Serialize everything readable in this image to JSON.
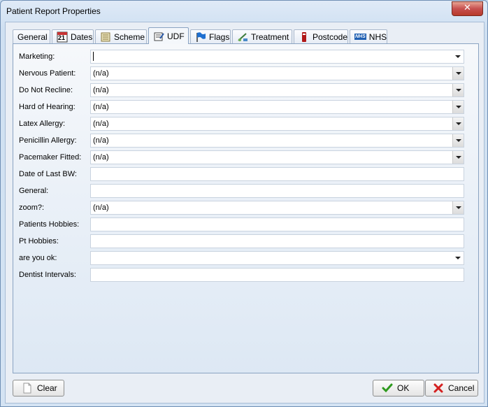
{
  "window": {
    "title": "Patient Report Properties",
    "close_glyph": "✕"
  },
  "tabs": [
    {
      "label": "General",
      "icon": "none"
    },
    {
      "label": "Dates",
      "icon": "calendar-icon",
      "icon_text": "21"
    },
    {
      "label": "Scheme",
      "icon": "scheme-icon"
    },
    {
      "label": "UDF",
      "icon": "udf-icon",
      "active": true
    },
    {
      "label": "Flags",
      "icon": "flag-icon"
    },
    {
      "label": "Treatment",
      "icon": "treatment-icon"
    },
    {
      "label": "Postcode",
      "icon": "postcode-icon"
    },
    {
      "label": "NHS",
      "icon": "nhs-logo-icon",
      "icon_text": "NHS"
    }
  ],
  "fields": [
    {
      "label": "Marketing:",
      "type": "combo-plain",
      "value": ""
    },
    {
      "label": "Nervous Patient:",
      "type": "combo",
      "value": "(n/a)"
    },
    {
      "label": "Do Not Recline:",
      "type": "combo",
      "value": "(n/a)"
    },
    {
      "label": "Hard of Hearing:",
      "type": "combo",
      "value": "(n/a)"
    },
    {
      "label": "Latex Allergy:",
      "type": "combo",
      "value": "(n/a)"
    },
    {
      "label": "Penicillin Allergy:",
      "type": "combo",
      "value": "(n/a)"
    },
    {
      "label": "Pacemaker Fitted:",
      "type": "combo",
      "value": "(n/a)"
    },
    {
      "label": "Date of Last BW:",
      "type": "text",
      "value": ""
    },
    {
      "label": "General:",
      "type": "text",
      "value": ""
    },
    {
      "label": "zoom?:",
      "type": "combo",
      "value": "(n/a)"
    },
    {
      "label": "Patients Hobbies:",
      "type": "text",
      "value": ""
    },
    {
      "label": "Pt Hobbies:",
      "type": "text",
      "value": ""
    },
    {
      "label": "are you ok:",
      "type": "combo-plain",
      "value": ""
    },
    {
      "label": "Dentist Intervals:",
      "type": "text",
      "value": ""
    }
  ],
  "buttons": {
    "clear": "Clear",
    "ok": "OK",
    "cancel": "Cancel"
  },
  "colors": {
    "ok_check": "#2e9a1e",
    "cancel_x": "#d42020",
    "flag_blue": "#1e6fd0",
    "postcode_red": "#b01818",
    "nhs_blue": "#1f5fb2"
  }
}
